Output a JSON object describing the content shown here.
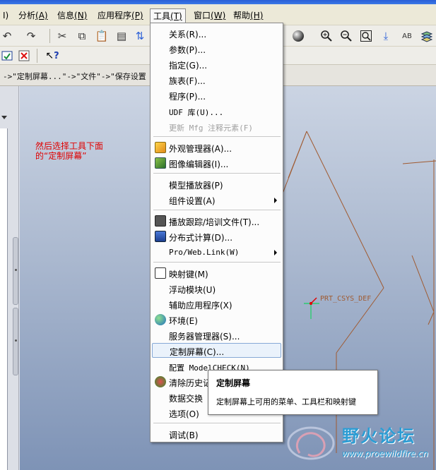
{
  "menubar": {
    "items": [
      {
        "label": "I)",
        "accel": ""
      },
      {
        "label": "分析",
        "accel": "(A)"
      },
      {
        "label": "信息",
        "accel": "(N)"
      },
      {
        "label": "应用程序",
        "accel": "(P)"
      },
      {
        "label": "工具",
        "accel": "(T)"
      },
      {
        "label": "窗口",
        "accel": "(W)"
      },
      {
        "label": "帮助",
        "accel": "(H)"
      }
    ]
  },
  "breadcrumb": "->\"定制屏幕...\"->\"文件\"->\"保存设置",
  "annotation": {
    "line1": "然后选择工具下面",
    "line2": "的“定制屏幕”"
  },
  "viewport": {
    "csys_label": "PRT_CSYS_DEF"
  },
  "tools_menu": {
    "items": [
      {
        "label": "关系(R)...",
        "icon": "",
        "disabled": false,
        "submenu": false
      },
      {
        "label": "参数(P)...",
        "icon": "",
        "disabled": false,
        "submenu": false
      },
      {
        "label": "指定(G)...",
        "icon": "",
        "disabled": false,
        "submenu": false
      },
      {
        "label": "族表(F)...",
        "icon": "",
        "disabled": false,
        "submenu": false
      },
      {
        "label": "程序(P)...",
        "icon": "",
        "disabled": false,
        "submenu": false
      },
      {
        "label": "UDF 库(U)...",
        "icon": "",
        "disabled": false,
        "submenu": false
      },
      {
        "label": "更新 Mfg 注释元素(F)",
        "icon": "",
        "disabled": true,
        "submenu": false
      },
      {
        "label": "外观管理器(A)...",
        "icon": "appearance-manager-icon",
        "disabled": false,
        "submenu": false
      },
      {
        "label": "图像编辑器(I)...",
        "icon": "image-editor-icon",
        "disabled": false,
        "submenu": false
      },
      {
        "label": "模型播放器(P)",
        "icon": "",
        "disabled": false,
        "submenu": false
      },
      {
        "label": "组件设置(A)",
        "icon": "",
        "disabled": false,
        "submenu": true
      },
      {
        "label": "播放跟踪/培训文件(T)...",
        "icon": "playback-trail-icon",
        "disabled": false,
        "submenu": false
      },
      {
        "label": "分布式计算(D)...",
        "icon": "distributed-computing-icon",
        "disabled": false,
        "submenu": false
      },
      {
        "label": "Pro/Web.Link(W)",
        "icon": "",
        "disabled": false,
        "submenu": true
      },
      {
        "label": "映射键(M)",
        "icon": "mapkey-icon",
        "disabled": false,
        "submenu": false
      },
      {
        "label": "浮动模块(U)",
        "icon": "",
        "disabled": false,
        "submenu": false
      },
      {
        "label": "辅助应用程序(X)",
        "icon": "",
        "disabled": false,
        "submenu": false
      },
      {
        "label": "环境(E)",
        "icon": "environment-globe-icon",
        "disabled": false,
        "submenu": false
      },
      {
        "label": "服务器管理器(S)...",
        "icon": "",
        "disabled": false,
        "submenu": false
      },
      {
        "label": "定制屏幕(C)...",
        "icon": "",
        "disabled": false,
        "submenu": false
      },
      {
        "label": "配置 ModelCHECK(N)",
        "icon": "",
        "disabled": false,
        "submenu": false
      },
      {
        "label": "清除历史记",
        "icon": "clear-history-icon",
        "disabled": false,
        "submenu": false
      },
      {
        "label": "数据交换",
        "icon": "",
        "disabled": false,
        "submenu": false
      },
      {
        "label": "选项(O)",
        "icon": "",
        "disabled": false,
        "submenu": false
      },
      {
        "label": "调试(B)",
        "icon": "",
        "disabled": false,
        "submenu": false
      }
    ]
  },
  "tooltip": {
    "title": "定制屏幕",
    "body": "定制屏幕上可用的菜单、工具栏和映射键"
  },
  "watermark": {
    "title": "野火论坛",
    "url": "www.proewildfire.cn"
  },
  "colors": {
    "annotation": "#e00000",
    "geometry": "#a05a30",
    "csys": "#2ecc71",
    "menu_hover": "#eaf2fb",
    "watermark": "#2c9dd4"
  }
}
